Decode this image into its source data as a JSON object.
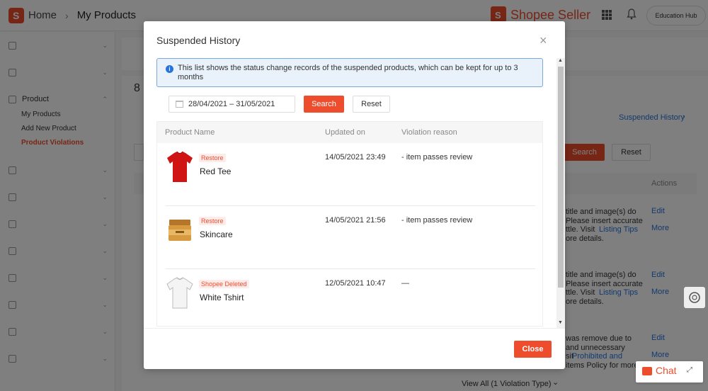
{
  "header": {
    "home": "Home",
    "page": "My Products",
    "brand": "Shopee Seller",
    "education_hub": "Education Hub"
  },
  "sidebar": {
    "section": "Product",
    "items": [
      "My Products",
      "Add New Product",
      "Product Violations"
    ]
  },
  "background": {
    "count": "8",
    "suspended_history_link": "Suspended History",
    "search": "Search",
    "reset": "Reset",
    "actions": "Actions",
    "rows": [
      {
        "l1": "title and image(s) do",
        "l2": "Please insert accurate",
        "l3": "ttle. Visit",
        "link": "Listing Tips",
        "l4": "ore details.",
        "edit": "Edit",
        "more": "More"
      },
      {
        "l1": "title and image(s) do",
        "l2": "Please insert accurate",
        "l3": "ttle. Visit",
        "link": "Listing Tips",
        "l4": "ore details.",
        "edit": "Edit",
        "more": "More"
      },
      {
        "l1": "was remove due to",
        "l2": "and unnecessary",
        "l3": "sit",
        "link": "Prohibited and",
        "l4": "items Policy for more",
        "edit": "Edit",
        "more": "More"
      }
    ],
    "view_all": "View All (1 Violation Type)",
    "chat": "Chat"
  },
  "modal": {
    "title": "Suspended History",
    "info": "This list shows the status change records of the suspended products, which can be kept for up to 3 months",
    "date_range": "28/04/2021 – 31/05/2021",
    "search": "Search",
    "reset": "Reset",
    "columns": [
      "Product Name",
      "Updated on",
      "Violation reason"
    ],
    "rows": [
      {
        "badge": "Restore",
        "name": "Red Tee",
        "updated": "14/05/2021 23:49",
        "reason": "- item passes review",
        "thumb": "red-tshirt"
      },
      {
        "badge": "Restore",
        "name": "Skincare",
        "updated": "14/05/2021 21:56",
        "reason": "- item passes review",
        "thumb": "gold-jar"
      },
      {
        "badge": "Shopee Deleted",
        "name": "White Tshirt",
        "updated": "12/05/2021 10:47",
        "reason": "—",
        "thumb": "white-tshirt"
      }
    ],
    "close": "Close"
  }
}
